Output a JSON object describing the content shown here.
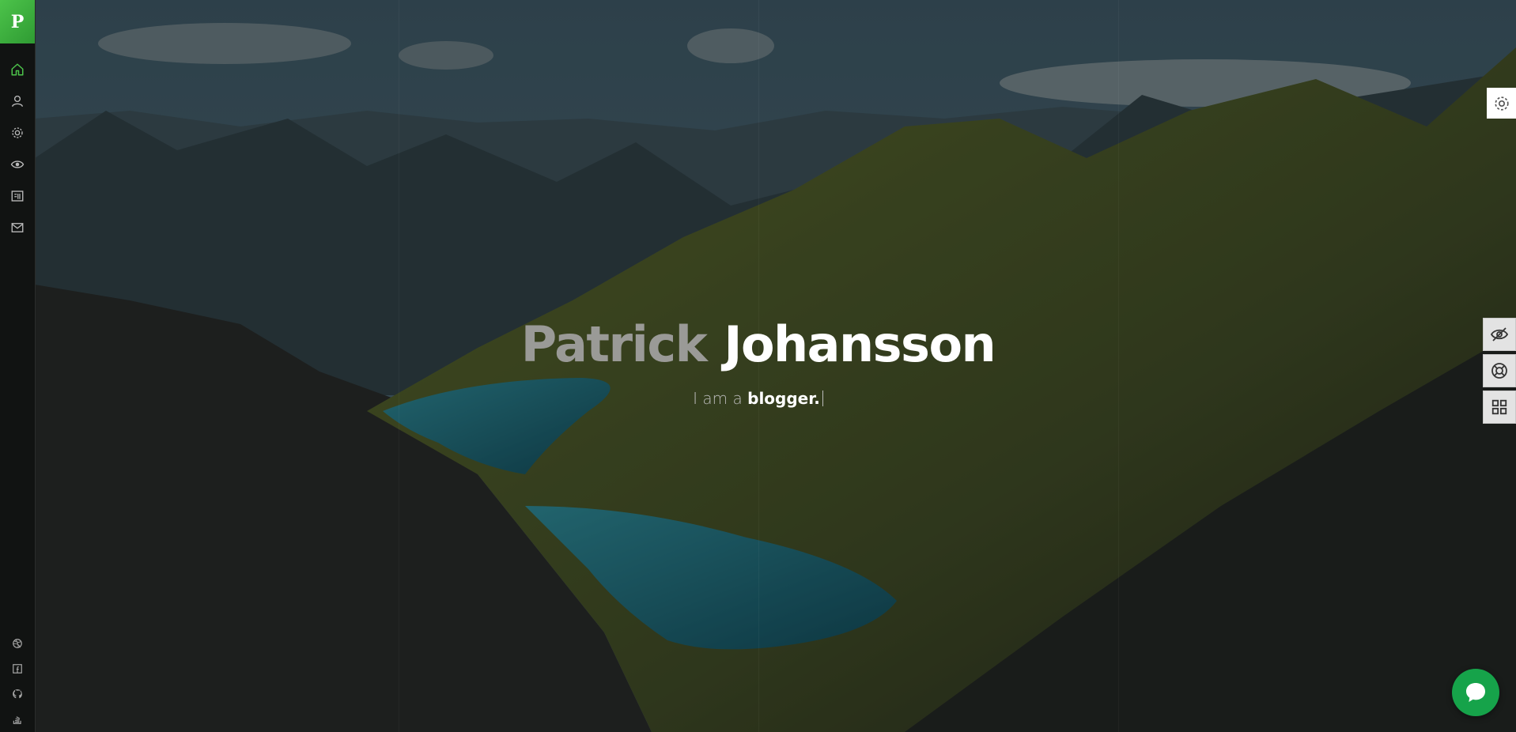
{
  "brand": {
    "logo_letter": "P",
    "accent": "#4cc34a"
  },
  "hero": {
    "first_name": "Patrick",
    "last_name": "Johansson",
    "tagline_prefix": "I am a",
    "tagline_role": "blogger."
  },
  "sidebar": {
    "nav": [
      {
        "icon": "home-icon",
        "active": true
      },
      {
        "icon": "user-icon"
      },
      {
        "icon": "gear-icon"
      },
      {
        "icon": "eye-icon"
      },
      {
        "icon": "newspaper-icon"
      },
      {
        "icon": "envelope-icon"
      }
    ],
    "social": [
      {
        "icon": "dribbble-icon"
      },
      {
        "icon": "facebook-icon"
      },
      {
        "icon": "github-icon"
      },
      {
        "icon": "stack-overflow-icon"
      }
    ]
  },
  "right_tools": [
    {
      "icon": "settings-gear-icon"
    },
    {
      "icon": "eye-slash-icon"
    },
    {
      "icon": "life-ring-icon"
    },
    {
      "icon": "grid-icon"
    }
  ],
  "chat": {
    "icon": "chat-bubble-icon",
    "color": "#16a34a"
  }
}
